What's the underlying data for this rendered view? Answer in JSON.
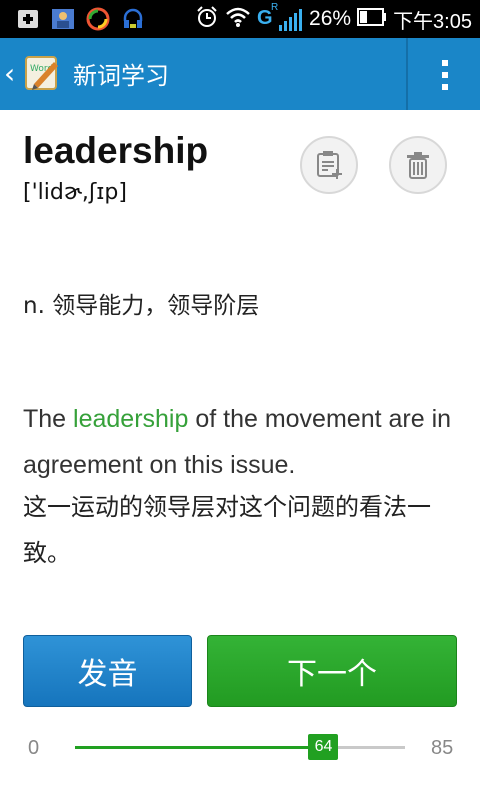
{
  "status_bar": {
    "icons": [
      "add-icon",
      "contacts-icon",
      "browser-icon",
      "headset-icon",
      "alarm-icon",
      "wifi-icon",
      "signal-icon",
      "battery-icon"
    ],
    "network_type": "G",
    "network_sub": "R",
    "battery": "26%",
    "time": "下午3:05"
  },
  "action_bar": {
    "title": "新词学习"
  },
  "word": {
    "headword": "leadership",
    "phonetic": "['lidɚ,ʃɪp]",
    "meaning": "n. 领导能力，领导阶层"
  },
  "example": {
    "before": "The ",
    "highlight": "leadership",
    "after": " of the movement are in agreement on this issue.",
    "translation": "这一运动的领导层对这个问题的看法一致。",
    "highlight_color": "#36a13a"
  },
  "buttons": {
    "pronounce": "发音",
    "next": "下一个"
  },
  "progress": {
    "min": "0",
    "max": "85",
    "current": "64",
    "value": 64,
    "total": 85
  },
  "colors": {
    "accent": "#1a86c8",
    "green": "#21a021"
  }
}
